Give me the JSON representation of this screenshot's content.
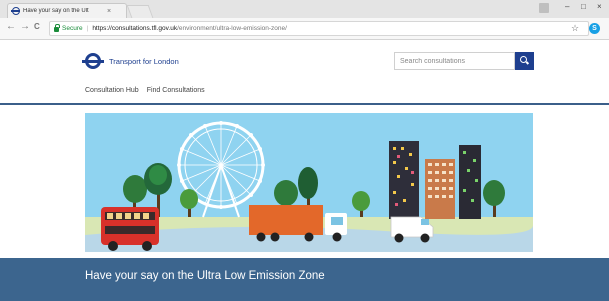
{
  "browser": {
    "tab_title": "Have your say on the Ult",
    "tab_close": "×",
    "window_controls": [
      "–",
      "□",
      "×"
    ],
    "nav": {
      "back": "←",
      "forward": "→",
      "reload": "C"
    },
    "secure_label": "Secure",
    "url_host": "https://consultations.tfl.gov.uk",
    "url_path": "/environment/ultra-low-emission-zone/",
    "star_icon": "☆",
    "extension_icon": "S"
  },
  "header": {
    "logo_text": "Transport for London",
    "search_placeholder": "Search consultations",
    "nav_links": [
      "Consultation Hub",
      "Find Consultations"
    ]
  },
  "hero": {
    "illustration": "london-street-scene",
    "sky_color": "#8fd3f0"
  },
  "banner": {
    "title": "Have your say on the Ultra Low Emission Zone",
    "color": "#3c658e"
  },
  "colors": {
    "brand": "#1e3f8f",
    "rule": "#3b5f8a"
  }
}
